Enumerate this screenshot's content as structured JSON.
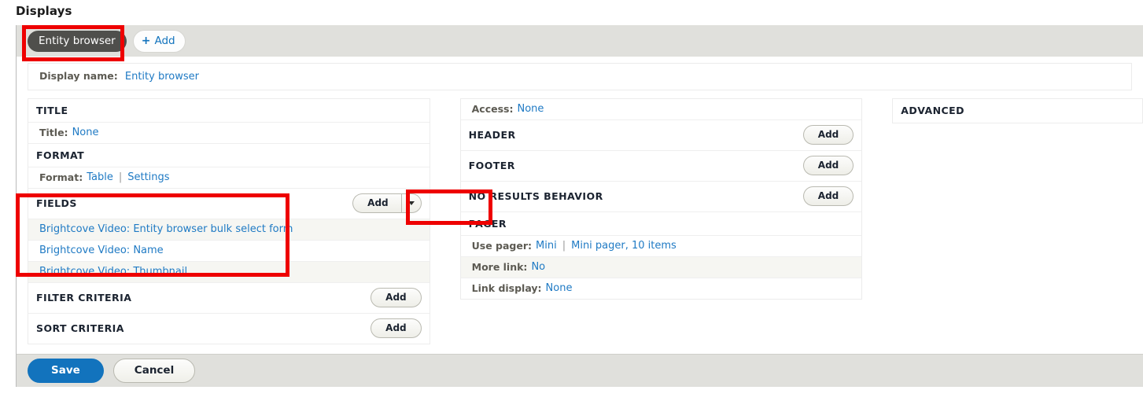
{
  "page": {
    "heading": "Displays"
  },
  "tabs": {
    "entity_browser_label": "Entity browser",
    "add_label": "Add",
    "plus_glyph": "+",
    "plus_icon_name": "plus-icon"
  },
  "display_name": {
    "label": "Display name:",
    "value": "Entity browser"
  },
  "columns": {
    "left": {
      "title_section": {
        "heading": "TITLE",
        "row_label": "Title:",
        "row_value": "None"
      },
      "format_section": {
        "heading": "FORMAT",
        "row_label": "Format:",
        "row_value": "Table",
        "separator": "|",
        "settings_link": "Settings"
      },
      "fields_section": {
        "heading": "FIELDS",
        "add_label": "Add",
        "items": [
          "Brightcove Video: Entity browser bulk select form",
          "Brightcove Video: Name",
          "Brightcove Video: Thumbnail"
        ]
      },
      "filter_criteria": {
        "heading": "FILTER CRITERIA",
        "add_label": "Add"
      },
      "sort_criteria": {
        "heading": "SORT CRITERIA",
        "add_label": "Add"
      }
    },
    "middle": {
      "access": {
        "label": "Access:",
        "value": "None"
      },
      "header": {
        "heading": "HEADER",
        "add_label": "Add"
      },
      "footer": {
        "heading": "FOOTER",
        "add_label": "Add"
      },
      "no_results": {
        "heading": "NO RESULTS BEHAVIOR",
        "add_label": "Add"
      },
      "pager": {
        "heading": "PAGER",
        "use_pager_label": "Use pager:",
        "use_pager_value": "Mini",
        "separator": "|",
        "pager_detail": "Mini pager, 10 items",
        "more_link_label": "More link:",
        "more_link_value": "No",
        "link_display_label": "Link display:",
        "link_display_value": "None"
      }
    },
    "right": {
      "heading": "ADVANCED"
    }
  },
  "actions": {
    "save_label": "Save",
    "cancel_label": "Cancel"
  },
  "colors": {
    "link": "#1f7ac4",
    "save_button": "#1273bd",
    "active_tab": "#4f4f4c",
    "bar_background": "#e0e0dc",
    "annotation": "#ee0000",
    "stripe": "#f6f6f2"
  }
}
